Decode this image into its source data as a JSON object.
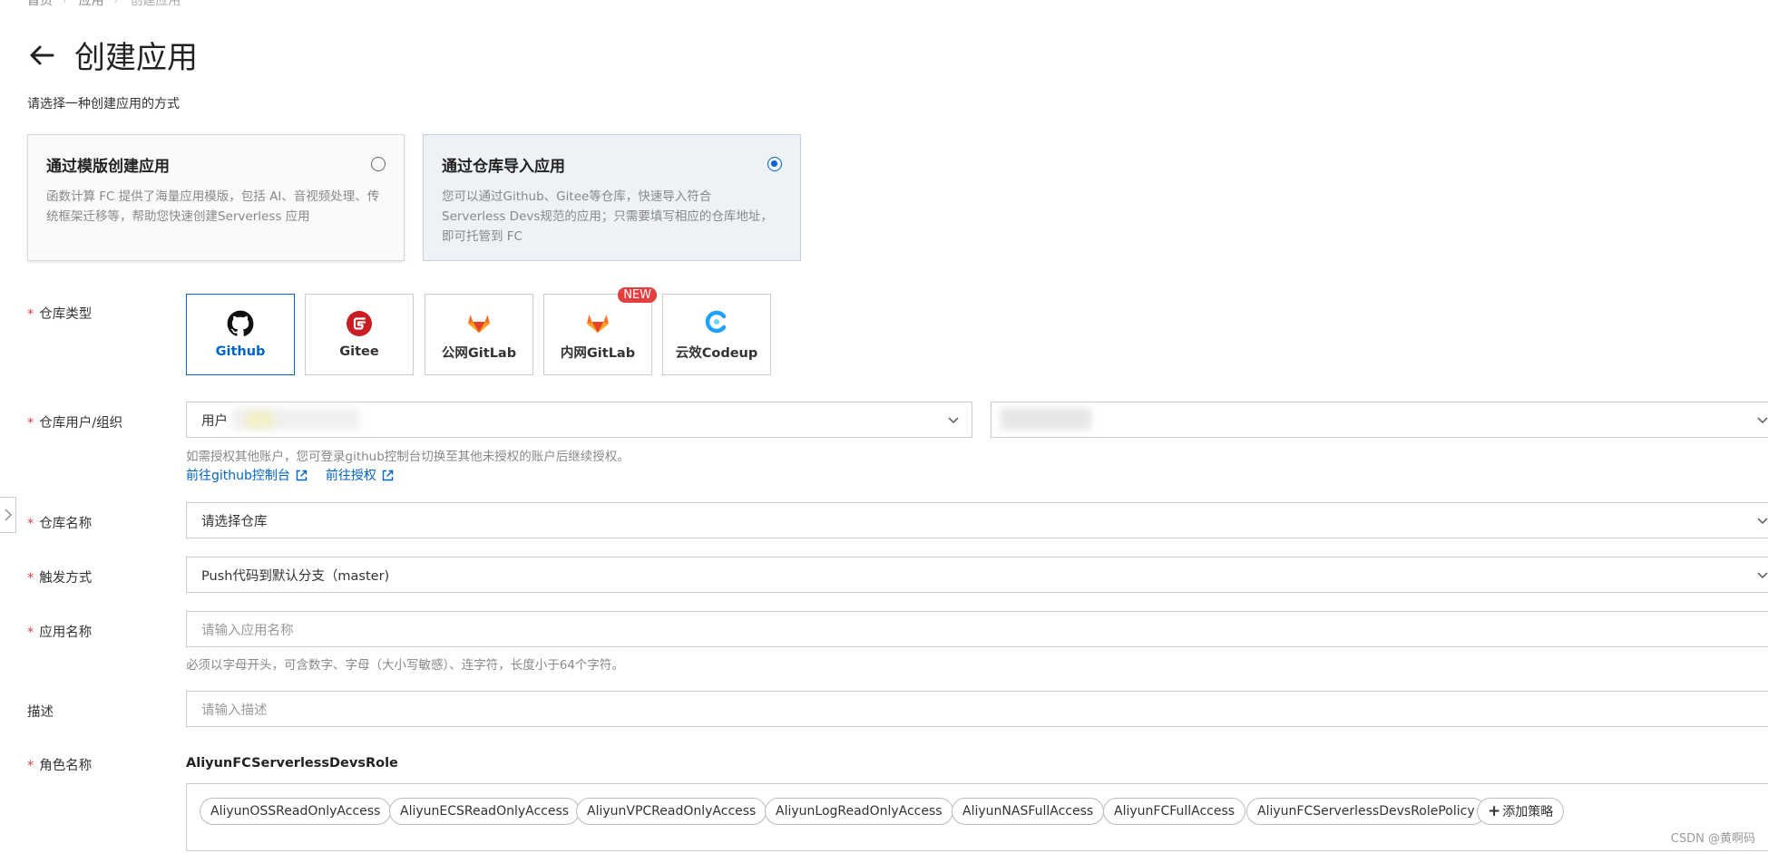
{
  "breadcrumb": {
    "home": "首页",
    "apps": "应用",
    "current": "创建应用"
  },
  "page_title": "创建应用",
  "subtitle": "请选择一种创建应用的方式",
  "methods": [
    {
      "title": "通过模版创建应用",
      "desc": "函数计算 FC 提供了海量应用模版，包括 AI、音视频处理、传统框架迁移等，帮助您快速创建Serverless 应用",
      "selected": false
    },
    {
      "title": "通过仓库导入应用",
      "desc": "您可以通过Github、Gitee等仓库，快速导入符合 Serverless Devs规范的应用；只需要填写相应的仓库地址，即可托管到 FC",
      "selected": true
    }
  ],
  "form": {
    "required_mark": "*",
    "repo_type_label": "仓库类型",
    "repo_types": [
      {
        "label": "Github",
        "icon": "github-icon",
        "active": true
      },
      {
        "label": "Gitee",
        "icon": "gitee-icon",
        "active": false
      },
      {
        "label": "公网GitLab",
        "icon": "gitlab-icon",
        "active": false
      },
      {
        "label": "内网GitLab",
        "icon": "gitlab-icon",
        "active": false,
        "badge": "NEW"
      },
      {
        "label": "云效Codeup",
        "icon": "codeup-icon",
        "active": false
      }
    ],
    "repo_user_label": "仓库用户/组织",
    "repo_user_value": "用户",
    "repo_user_hint": "如需授权其他账户，您可登录github控制台切换至其他未授权的账户后继续授权。",
    "link_console": "前往github控制台",
    "link_authorize": "前往授权",
    "repo_name_label": "仓库名称",
    "repo_name_placeholder": "请选择仓库",
    "trigger_label": "触发方式",
    "trigger_value": "Push代码到默认分支（master)",
    "app_name_label": "应用名称",
    "app_name_placeholder": "请输入应用名称",
    "app_name_hint": "必须以字母开头，可含数字、字母（大小写敏感）、连字符，长度小于64个字符。",
    "desc_label": "描述",
    "desc_placeholder": "请输入描述",
    "role_label": "角色名称",
    "role_name": "AliyunFCServerlessDevsRole",
    "policies": [
      "AliyunOSSReadOnlyAccess",
      "AliyunECSReadOnlyAccess",
      "AliyunVPCReadOnlyAccess",
      "AliyunLogReadOnlyAccess",
      "AliyunNASFullAccess",
      "AliyunFCFullAccess",
      "AliyunFCServerlessDevsRolePolicy"
    ],
    "add_policy": "添加策略",
    "add_policy_plus": "+"
  },
  "watermark": "CSDN @黄啊码",
  "colors": {
    "primary": "#0064c8",
    "required": "#e03c3c",
    "badge": "#e53e3e"
  }
}
